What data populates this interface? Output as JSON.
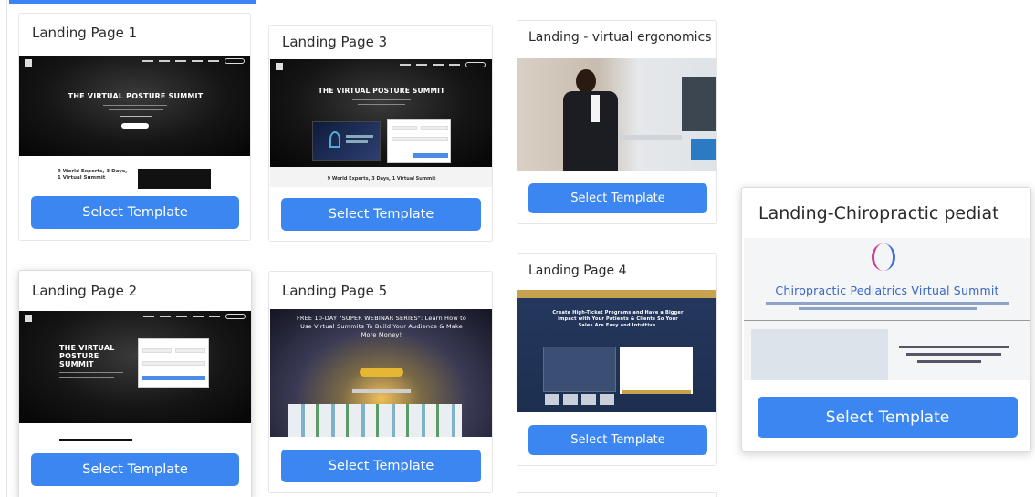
{
  "cards": [
    {
      "id": "landing-page-1",
      "title": "Landing Page 1",
      "thumb_hero": "THE VIRTUAL POSTURE SUMMIT",
      "thumb_sub": "9 World Experts, 3 Days, 1 Virtual Summit",
      "button": "Select Template"
    },
    {
      "id": "landing-page-2",
      "title": "Landing Page 2",
      "thumb_hero": "THE VIRTUAL POSTURE SUMMIT",
      "button": "Select Template"
    },
    {
      "id": "landing-page-3",
      "title": "Landing Page 3",
      "thumb_hero": "THE VIRTUAL POSTURE SUMMIT",
      "thumb_sub": "9 World Experts, 3 Days, 1 Virtual Summit",
      "button": "Select Template"
    },
    {
      "id": "landing-page-5",
      "title": "Landing Page 5",
      "thumb_hero": "FREE 10-DAY \"SUPER WEBINAR SERIES\": Learn How to Use Virtual Summits To Build Your Audience & Make More Money!",
      "button": "Select Template"
    },
    {
      "id": "landing-virtual-ergonomics",
      "title": "Landing - virtual ergonomics",
      "button": "Select Template"
    },
    {
      "id": "landing-page-4",
      "title": "Landing Page 4",
      "thumb_hero": "Create High-Ticket Programs and Have a Bigger Impact with Your Patients & Clients So Your Sales Are Easy and Intuitive.",
      "button": "Select Template"
    },
    {
      "id": "landing-chiropractic-pediat",
      "title": "Landing-Chiropractic pediat",
      "thumb_hero": "Chiropractic Pediatrics Virtual Summit",
      "button": "Select Template"
    }
  ],
  "colors": {
    "accent": "#3b86f0",
    "tab_indicator": "#3b82f6"
  }
}
